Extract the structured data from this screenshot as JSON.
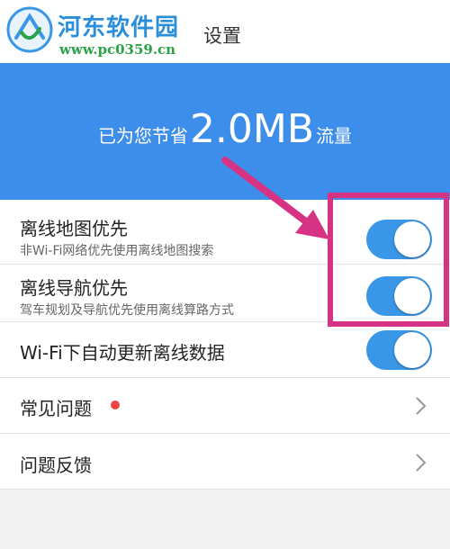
{
  "watermark": {
    "site_name": "河东软件园",
    "url": "www.pc0359.cn"
  },
  "header": {
    "title": "设置"
  },
  "banner": {
    "prefix": "已为您节省",
    "amount": "2.0MB",
    "suffix": "流量"
  },
  "settings": [
    {
      "title": "离线地图优先",
      "subtitle": "非Wi-Fi网络优先使用离线地图搜索",
      "enabled": true
    },
    {
      "title": "离线导航优先",
      "subtitle": "驾车规划及导航优先使用离线算路方式",
      "enabled": true
    },
    {
      "title": "Wi-Fi下自动更新离线数据",
      "enabled": true
    },
    {
      "title": "常见问题",
      "badge": "unread-dot"
    },
    {
      "title": "问题反馈"
    }
  ],
  "colors": {
    "accent": "#3d8eea",
    "toggle_on": "#3a97e8",
    "badge": "#ee4444",
    "annotation": "#d63384",
    "watermark_title": "#2a8fd8",
    "watermark_url": "#2aa246"
  }
}
